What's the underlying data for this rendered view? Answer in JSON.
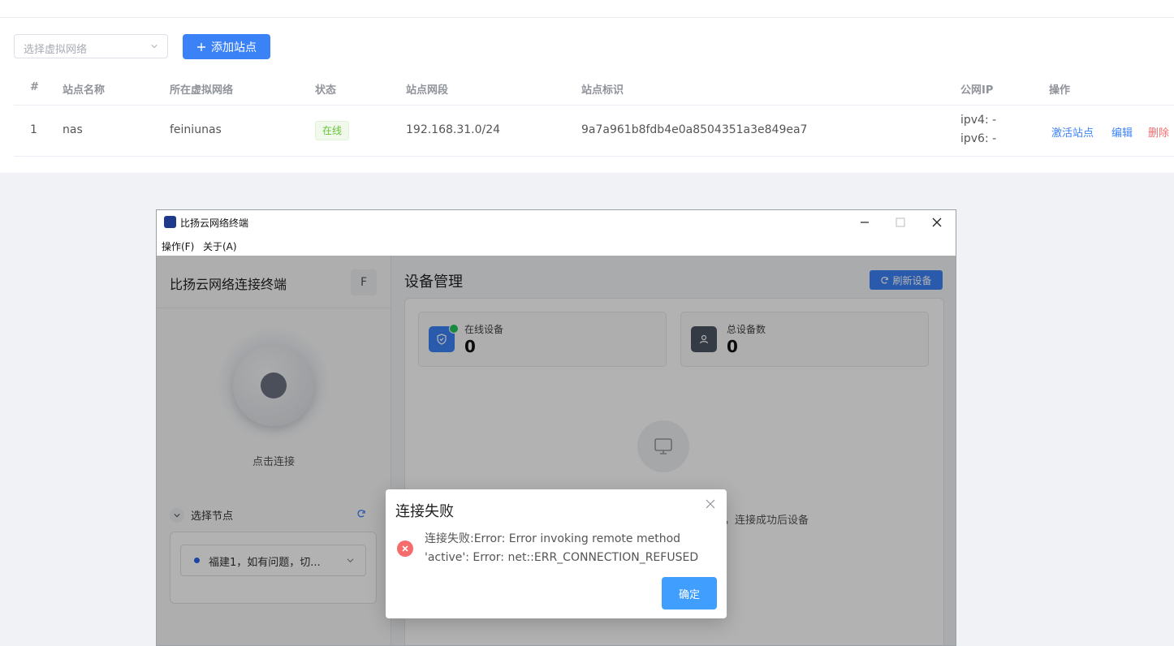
{
  "toolbar": {
    "vnet_placeholder": "选择虚拟网络",
    "add_site_label": "添加站点"
  },
  "table": {
    "headers": [
      "#",
      "站点名称",
      "所在虚拟网络",
      "状态",
      "站点网段",
      "站点标识",
      "公网IP",
      "操作"
    ],
    "rows": [
      {
        "index": "1",
        "name": "nas",
        "vnet": "feiniunas",
        "status": "在线",
        "segment": "192.168.31.0/24",
        "id": "9a7a961b8fdb4e0a8504351a3e849ea7",
        "ipv4": "ipv4: -",
        "ipv6": "ipv6: -",
        "actions": [
          "激活站点",
          "编辑",
          "删除"
        ]
      }
    ]
  },
  "window": {
    "title": "比扬云网络终端",
    "menus": [
      "操作(F)",
      "关于(A)"
    ]
  },
  "sidebar": {
    "title": "比扬云网络连接终端",
    "avatar": "F",
    "connect_label": "点击连接",
    "node_section": "选择节点",
    "node_selected": "福建1，如有问题，切..."
  },
  "device_panel": {
    "title": "设备管理",
    "refresh_label": "刷新设备",
    "online_label": "在线设备",
    "online_value": "0",
    "total_label": "总设备数",
    "total_value": "0",
    "empty_text": "点，连接成功后设备"
  },
  "dialog": {
    "title": "连接失败",
    "message": "连接失败:Error: Error invoking remote method 'active': Error: net::ERR_CONNECTION_REFUSED",
    "ok_label": "确定"
  },
  "colors": {
    "primary": "#3b82f6",
    "success": "#67c23a",
    "danger": "#f56c6c",
    "dialog_button": "#409eff"
  }
}
